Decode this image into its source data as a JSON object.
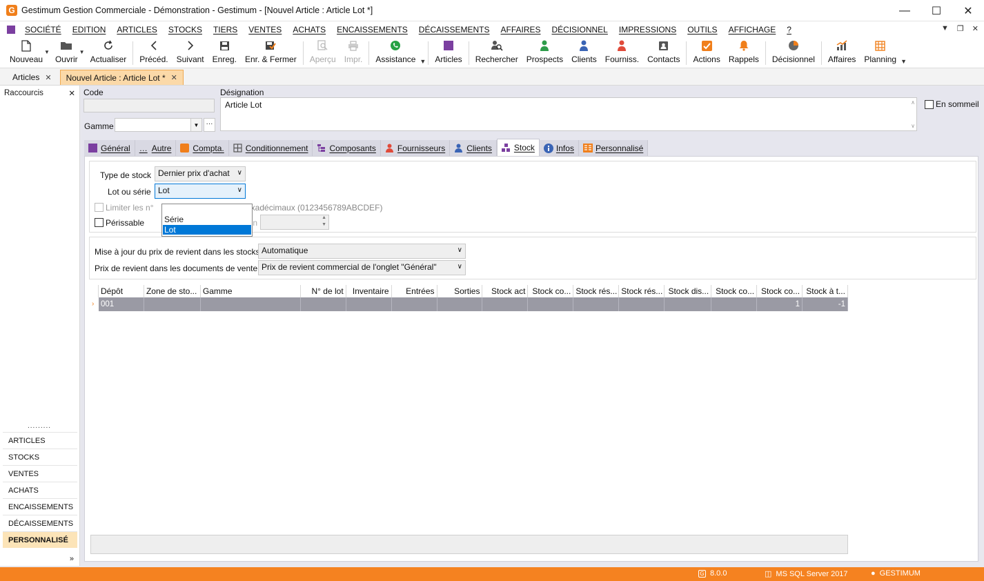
{
  "window": {
    "title": "Gestimum Gestion Commerciale - Démonstration - Gestimum - [Nouvel Article : Article Lot *]",
    "logo_letter": "G"
  },
  "menu": {
    "items": [
      "SOCIÉTÉ",
      "EDITION",
      "ARTICLES",
      "STOCKS",
      "TIERS",
      "VENTES",
      "ACHATS",
      "ENCAISSEMENTS",
      "DÉCAISSEMENTS",
      "AFFAIRES",
      "DÉCISIONNEL",
      "IMPRESSIONS",
      "OUTILS",
      "AFFICHAGE",
      "?"
    ]
  },
  "toolbar": {
    "nouveau": "Nouveau",
    "ouvrir": "Ouvrir",
    "actualiser": "Actualiser",
    "preced": "Précéd.",
    "suivant": "Suivant",
    "enreg": "Enreg.",
    "enr_fermer": "Enr. & Fermer",
    "apercu": "Aperçu",
    "impr": "Impr.",
    "assistance": "Assistance",
    "articles": "Articles",
    "rechercher": "Rechercher",
    "prospects": "Prospects",
    "clients": "Clients",
    "fourniss": "Fourniss.",
    "contacts": "Contacts",
    "actions": "Actions",
    "rappels": "Rappels",
    "decisionnel": "Décisionnel",
    "affaires": "Affaires",
    "planning": "Planning"
  },
  "doctabs": {
    "articles": "Articles",
    "nouvel_article": "Nouvel Article : Article Lot *"
  },
  "leftpanel": {
    "title": "Raccourcis",
    "dots": ".........",
    "items": [
      "ARTICLES",
      "STOCKS",
      "VENTES",
      "ACHATS",
      "ENCAISSEMENTS",
      "DÉCAISSEMENTS",
      "PERSONNALISÉ"
    ]
  },
  "form": {
    "code_label": "Code",
    "code_value": "",
    "designation_label": "Désignation",
    "designation_value": "Article Lot",
    "gamme_label": "Gamme",
    "gamme_value": "",
    "en_sommeil": "En sommeil"
  },
  "subtabs": [
    "Général",
    "Autre",
    "Compta.",
    "Conditionnement",
    "Composants",
    "Fournisseurs",
    "Clients",
    "Stock",
    "Infos",
    "Personnalisé"
  ],
  "stock": {
    "type_stock_label": "Type de stock",
    "type_stock_value": "Dernier prix d'achat",
    "lot_serie_label": "Lot ou série",
    "lot_serie_value": "Lot",
    "dropdown_options": [
      "Série",
      "Lot"
    ],
    "limiter_label": "Limiter les n°",
    "hexa_text": "exadécimaux (0123456789ABCDEF)",
    "perissable_label": "Périssable",
    "peremption_partial": "ion",
    "maj_label": "Mise à jour du prix de revient dans les stocks",
    "maj_value": "Automatique",
    "prix_docs_label": "Prix de revient dans les documents de vente",
    "prix_docs_value": "Prix de revient commercial de l'onglet \"Général\""
  },
  "grid": {
    "headers": [
      "Dépôt",
      "Zone de sto...",
      "Gamme",
      "N° de lot",
      "Inventaire",
      "Entrées",
      "Sorties",
      "Stock act",
      "Stock co...",
      "Stock rés...",
      "Stock rés...",
      "Stock dis...",
      "Stock co...",
      "Stock co...",
      "Stock à t..."
    ],
    "row": [
      "001",
      "",
      "",
      "",
      "",
      "",
      "",
      "",
      "",
      "",
      "",
      "",
      "",
      "1",
      "-1"
    ]
  },
  "status": {
    "version": "8.0.0",
    "server": "MS SQL Server 2017",
    "user": "GESTIMUM"
  },
  "colors": {
    "accent": "#f58220",
    "tab_active": "#fbd9a8",
    "selection": "#0078d7"
  }
}
